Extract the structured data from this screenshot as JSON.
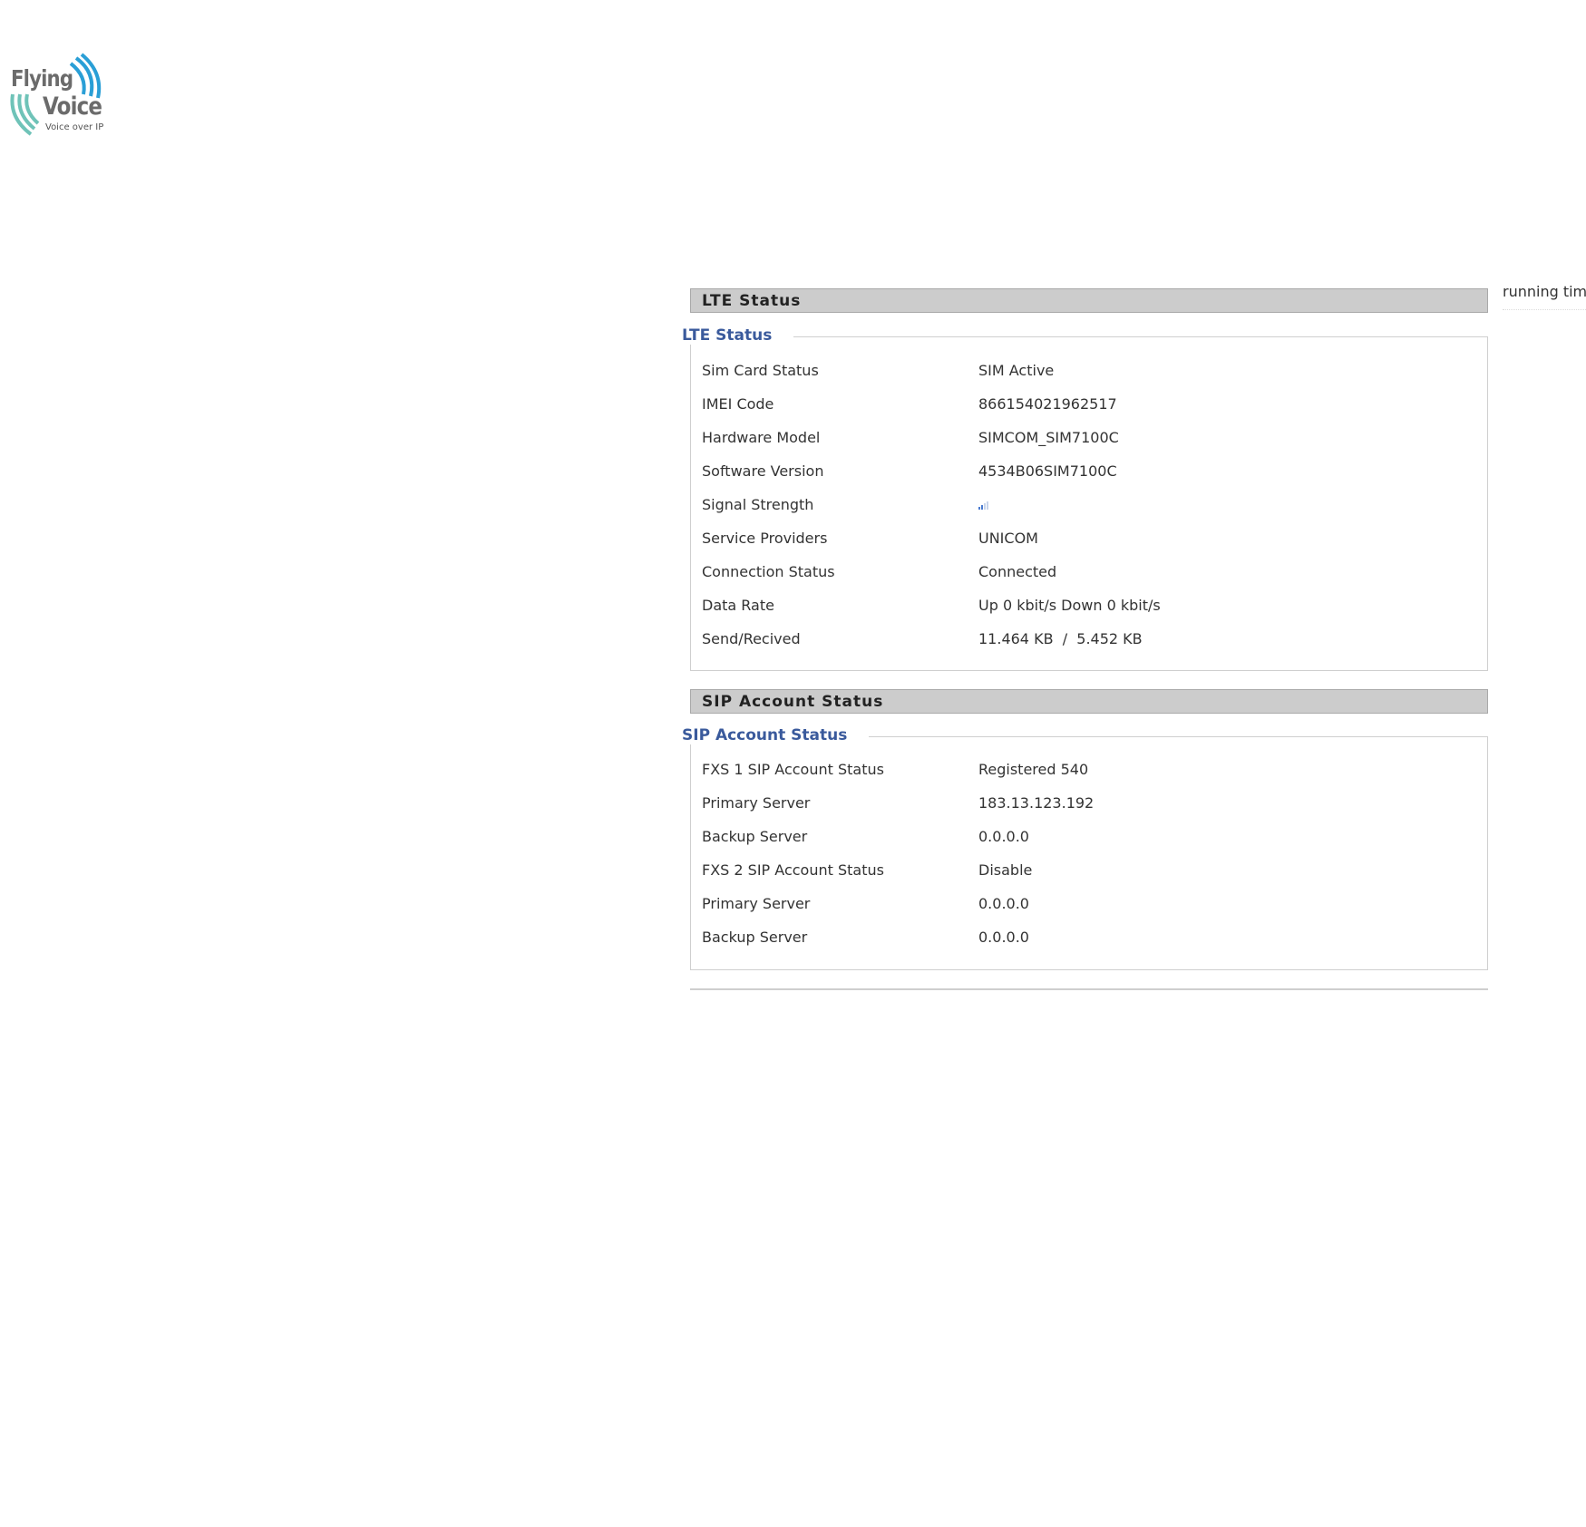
{
  "logo": {
    "line1": "Flying",
    "line2": "Voice",
    "tagline": "Voice over IP"
  },
  "running_time_label": "running time",
  "lte": {
    "header": "LTE Status",
    "legend": "LTE Status",
    "rows": [
      {
        "label": "Sim Card Status",
        "value": "SIM Active"
      },
      {
        "label": "IMEI Code",
        "value": "866154021962517"
      },
      {
        "label": "Hardware Model",
        "value": "SIMCOM_SIM7100C"
      },
      {
        "label": "Software Version",
        "value": "4534B06SIM7100C"
      },
      {
        "label": "Signal Strength",
        "value": ""
      },
      {
        "label": "Service Providers",
        "value": "UNICOM"
      },
      {
        "label": "Connection Status",
        "value": "Connected"
      },
      {
        "label": "Data Rate",
        "value": "Up 0 kbit/s Down 0 kbit/s"
      },
      {
        "label": "Send/Recived",
        "value": "11.464 KB  /  5.452 KB"
      }
    ],
    "signal_icon": "signal-strength-icon",
    "signal_level": 0.25
  },
  "sip": {
    "header": "SIP Account Status",
    "legend": "SIP Account Status",
    "rows": [
      {
        "label": "FXS 1 SIP Account Status",
        "value": "Registered 540"
      },
      {
        "label": "Primary Server",
        "value": "183.13.123.192"
      },
      {
        "label": "Backup Server",
        "value": "0.0.0.0"
      },
      {
        "label": "FXS 2 SIP Account Status",
        "value": "Disable"
      },
      {
        "label": "Primary Server",
        "value": "0.0.0.0"
      },
      {
        "label": "Backup Server",
        "value": "0.0.0.0"
      }
    ]
  },
  "colors": {
    "legend": "#3a5a9c",
    "header_bg": "#cccccc",
    "logo_accent": "#2a9fd6",
    "logo_teal": "#6fc3b8"
  }
}
